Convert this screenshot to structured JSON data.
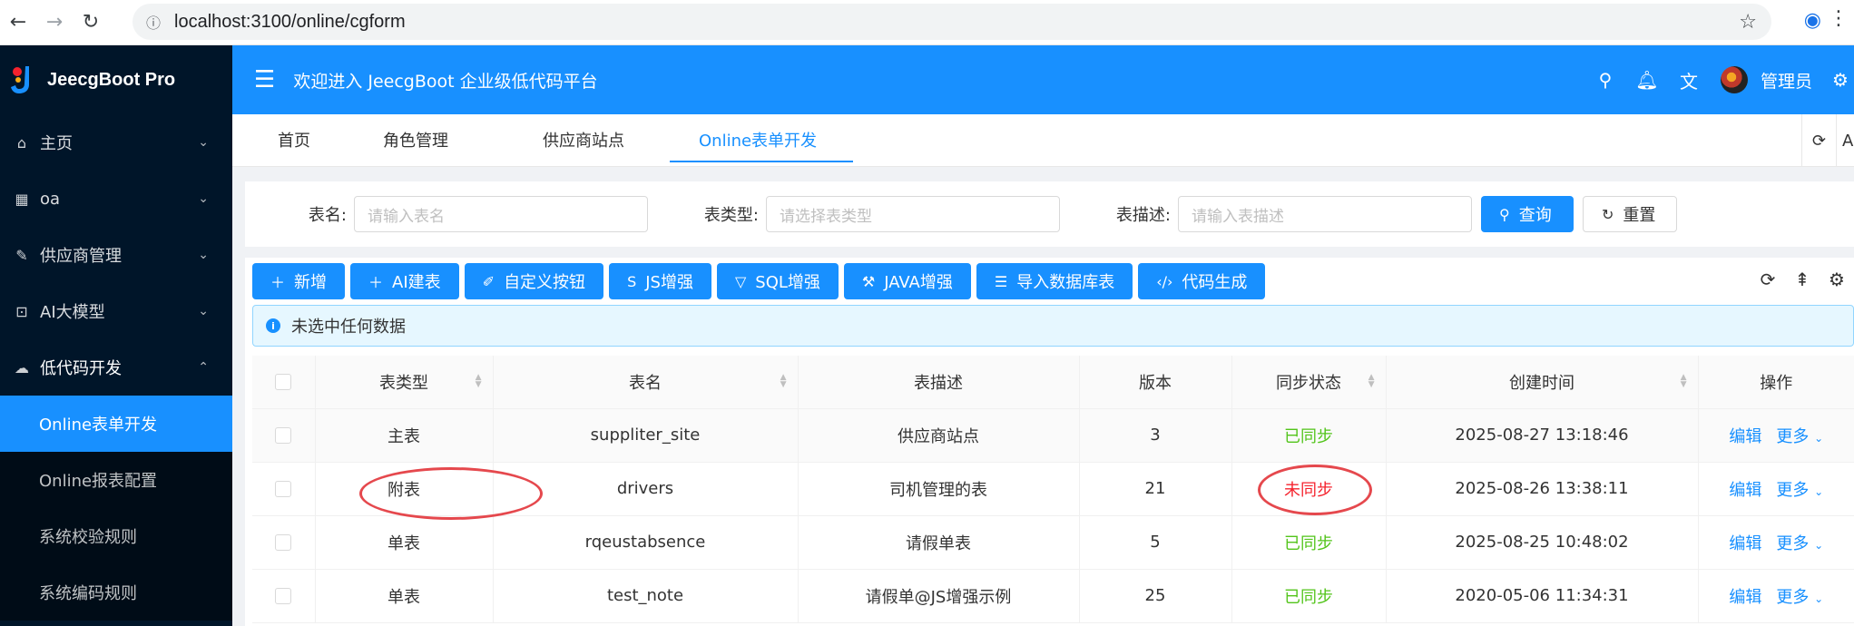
{
  "browser": {
    "back": "←",
    "forward": "→",
    "reload": "↻",
    "url": "localhost:3100/online/cgform"
  },
  "sidebar": {
    "brand": "JeecgBoot Pro",
    "items": [
      {
        "label": "主页",
        "icon": "home-icon",
        "glyph": "⌂"
      },
      {
        "label": "oa",
        "icon": "grid-icon",
        "glyph": "▦"
      },
      {
        "label": "供应商管理",
        "icon": "supplier-icon",
        "glyph": "✎"
      },
      {
        "label": "AI大模型",
        "icon": "ai-icon",
        "glyph": "⊡"
      },
      {
        "label": "低代码开发",
        "icon": "cloud-icon",
        "glyph": "☁"
      }
    ],
    "sub_items": [
      {
        "label": "Online表单开发"
      },
      {
        "label": "Online报表配置"
      },
      {
        "label": "系统校验规则"
      },
      {
        "label": "系统编码规则"
      }
    ]
  },
  "header": {
    "welcome": "欢迎进入 JeecgBoot 企业级低代码平台",
    "username": "管理员"
  },
  "tabs": [
    {
      "label": "首页"
    },
    {
      "label": "角色管理"
    },
    {
      "label": "供应商站点"
    },
    {
      "label": "Online表单开发"
    }
  ],
  "search": {
    "table_name_label": "表名:",
    "table_name_placeholder": "请输入表名",
    "table_type_label": "表类型:",
    "table_type_placeholder": "请选择表类型",
    "table_desc_label": "表描述:",
    "table_desc_placeholder": "请输入表描述",
    "query_label": "查询",
    "reset_label": "重置"
  },
  "toolbar": {
    "buttons": [
      {
        "label": "新增",
        "glyph": "＋"
      },
      {
        "label": "AI建表",
        "glyph": "＋"
      },
      {
        "label": "自定义按钮",
        "glyph": "✐"
      },
      {
        "label": "JS增强",
        "glyph": "S"
      },
      {
        "label": "SQL增强",
        "glyph": "▽"
      },
      {
        "label": "JAVA增强",
        "glyph": "⚒"
      },
      {
        "label": "导入数据库表",
        "glyph": "☰"
      },
      {
        "label": "代码生成",
        "glyph": "‹/›"
      }
    ]
  },
  "alert": {
    "text": "未选中任何数据"
  },
  "table": {
    "columns": [
      "表类型",
      "表名",
      "表描述",
      "版本",
      "同步状态",
      "创建时间",
      "操作"
    ],
    "rows": [
      {
        "type": "主表",
        "name": "suppliter_site",
        "desc": "供应商站点",
        "version": "3",
        "status": "已同步",
        "status_color": "#52c41a",
        "created": "2025-08-27 13:18:46",
        "edit": "编辑",
        "more": "更多"
      },
      {
        "type": "附表",
        "name": "drivers",
        "desc": "司机管理的表",
        "version": "21",
        "status": "未同步",
        "status_color": "#f5222d",
        "created": "2025-08-26 13:38:11",
        "edit": "编辑",
        "more": "更多"
      },
      {
        "type": "单表",
        "name": "rqeustabsence",
        "desc": "请假单表",
        "version": "5",
        "status": "已同步",
        "status_color": "#52c41a",
        "created": "2025-08-25 10:48:02",
        "edit": "编辑",
        "more": "更多"
      },
      {
        "type": "单表",
        "name": "test_note",
        "desc": "请假单@JS增强示例",
        "version": "25",
        "status": "已同步",
        "status_color": "#52c41a",
        "created": "2020-05-06 11:34:31",
        "edit": "编辑",
        "more": "更多"
      }
    ]
  },
  "colors": {
    "primary": "#1890ff",
    "sidebar_bg": "#001529",
    "synced": "#52c41a",
    "unsynced": "#f5222d",
    "annotation": "#e5484d"
  }
}
